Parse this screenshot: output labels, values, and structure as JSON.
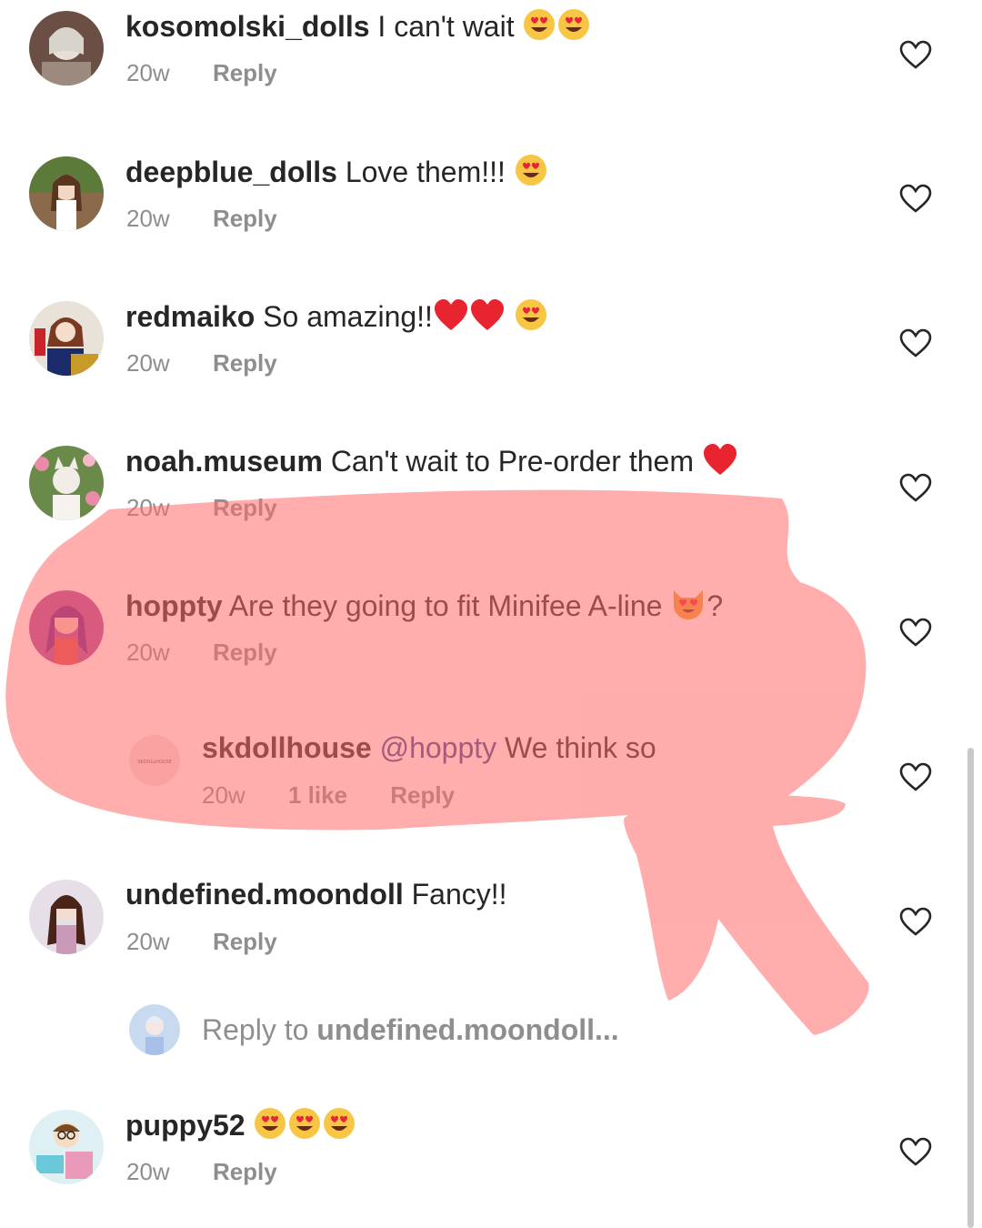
{
  "comments": [
    {
      "username": "kosomolski_dolls",
      "text": "I can't wait",
      "emojis": [
        "heart-eyes",
        "heart-eyes"
      ],
      "time": "20w",
      "reply": "Reply"
    },
    {
      "username": "deepblue_dolls",
      "text": "Love them!!!",
      "emojis": [
        "heart-eyes"
      ],
      "time": "20w",
      "reply": "Reply"
    },
    {
      "username": "redmaiko",
      "text": "So amazing!!",
      "emojis": [
        "red-heart",
        "red-heart",
        "heart-eyes"
      ],
      "time": "20w",
      "reply": "Reply"
    },
    {
      "username": "noah.museum",
      "text": "Can't wait to Pre-order them",
      "emojis": [
        "red-heart"
      ],
      "time": "20w",
      "reply": "Reply"
    },
    {
      "username": "hoppty",
      "text": "Are they going to fit Minifee A-line",
      "emojis": [
        "heart-eyes-cat"
      ],
      "suffix": "?",
      "time": "20w",
      "reply": "Reply"
    },
    {
      "username": "skdollhouse",
      "mention": "@hoppty",
      "text": "We think so",
      "time": "20w",
      "likes": "1 like",
      "reply": "Reply",
      "avatar_label": "SKDOLLHOUSE"
    },
    {
      "username": "undefined.moondoll",
      "text": "Fancy!!",
      "time": "20w",
      "reply": "Reply"
    },
    {
      "username": "puppy52",
      "text": "",
      "emojis": [
        "heart-eyes",
        "heart-eyes",
        "heart-eyes"
      ],
      "time": "20w",
      "reply": "Reply"
    }
  ],
  "reply_input": {
    "prefix": "Reply to",
    "target": "undefined.moondoll..."
  },
  "colors": {
    "highlight": "#ff7070",
    "muted": "#8e8e8e",
    "text": "#262626",
    "mention": "#3a4a8c"
  }
}
